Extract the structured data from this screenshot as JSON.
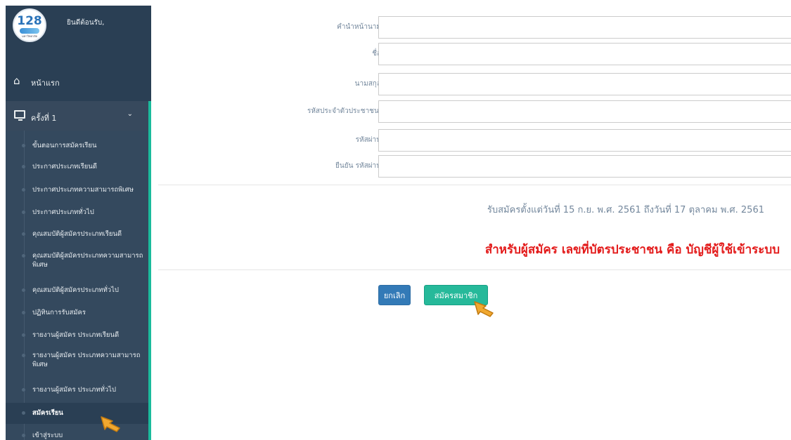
{
  "sidebar": {
    "logo": {
      "number": "128",
      "subtitle": "มหาวิทยาลัย"
    },
    "welcome_text": "ยินดีต้อนรับ,",
    "home_label": "หน้าแรก",
    "round_label": "ครั้งที่ 1",
    "items": [
      {
        "label": "ขั้นตอนการสมัครเรียน"
      },
      {
        "label": "ประกาศประเภทเรียนดี"
      },
      {
        "label": "ประกาศประเภทความสามารถพิเศษ"
      },
      {
        "label": "ประกาศประเภททั่วไป"
      },
      {
        "label": "คุณสมบัติผู้สมัครประเภทเรียนดี"
      },
      {
        "label": "คุณสมบัติผู้สมัครประเภทความสามารถพิเศษ"
      },
      {
        "label": "คุณสมบัติผู้สมัครประเภททั่วไป"
      },
      {
        "label": "ปฏิทินการรับสมัคร"
      },
      {
        "label": "รายงานผู้สมัคร ประเภทเรียนดี"
      },
      {
        "label": "รายงานผู้สมัคร ประเภทความสามารถพิเศษ"
      },
      {
        "label": "รายงานผู้สมัคร ประเภททั่วไป"
      },
      {
        "label": "สมัครเรียน"
      },
      {
        "label": "เข้าสู่ระบบ"
      }
    ]
  },
  "form": {
    "fields": [
      {
        "label": "คำนำหน้านาม*",
        "value": ""
      },
      {
        "label": "ชื่อ*",
        "value": ""
      },
      {
        "label": "นามสกุล*",
        "value": ""
      },
      {
        "label": "รหัสประจำตัวประชาชน *",
        "value": ""
      },
      {
        "label": "รหัสผ่าน*",
        "value": ""
      },
      {
        "label": "ยืนยัน รหัสผ่าน*",
        "value": ""
      }
    ],
    "info_text": "รับสมัครตั้งแต่วันที่ 15 ก.ย. พ.ศ. 2561 ถึงวันที่ 17 ตุลาคม พ.ศ. 2561",
    "notice_text": "สำหรับผู้สมัคร เลขที่บัตรประชาชน คือ บัญชีผู้ใช้เข้าระบบ",
    "cancel_label": "ยกเลิก",
    "submit_label": "สมัครสมาชิก"
  },
  "colors": {
    "sidebar_bg": "#2a3f54",
    "accent": "#1abb9c",
    "notice": "#e31b1b",
    "cancel_btn": "#337ab7",
    "submit_btn": "#26b99a"
  },
  "icons": {
    "home": "home-icon",
    "round": "monitor-icon",
    "chevron": "chevron-down-icon",
    "cursor": "hand-cursor-icon"
  }
}
